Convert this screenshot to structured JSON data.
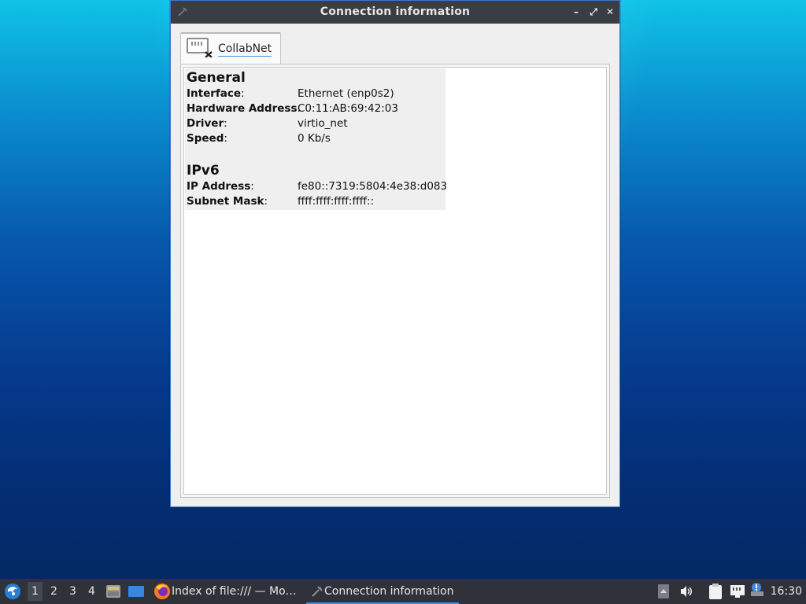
{
  "window": {
    "title": "Connection information",
    "controls": {
      "minimize": "–",
      "maximize": "⤢",
      "close": "✕"
    },
    "tab": {
      "label": "CollabNet",
      "icon": "network-disconnected-icon"
    },
    "sections": [
      {
        "title": "General",
        "rows": [
          {
            "key": "Interface",
            "value": "Ethernet (enp0s2)"
          },
          {
            "key": "Hardware Address",
            "value": "C0:11:AB:69:42:03"
          },
          {
            "key": "Driver",
            "value": "virtio_net"
          },
          {
            "key": "Speed",
            "value": "0 Kb/s"
          }
        ]
      },
      {
        "title": "IPv6",
        "rows": [
          {
            "key": "IP Address",
            "value": "fe80::7319:5804:4e38:d083"
          },
          {
            "key": "Subnet Mask",
            "value": "ffff:ffff:ffff:ffff::"
          }
        ]
      }
    ]
  },
  "taskbar": {
    "workspaces": [
      "1",
      "2",
      "3",
      "4"
    ],
    "active_workspace": "1",
    "tasks": [
      {
        "label": "Index of file:/// — Mo…",
        "icon": "firefox-icon"
      },
      {
        "label": "Connection information",
        "icon": "network-settings-icon"
      }
    ],
    "clock": "16:30",
    "tray_icons": [
      "tray-arrow-icon",
      "volume-icon",
      "clipboard-icon",
      "network-icon",
      "update-notifier-icon"
    ]
  }
}
